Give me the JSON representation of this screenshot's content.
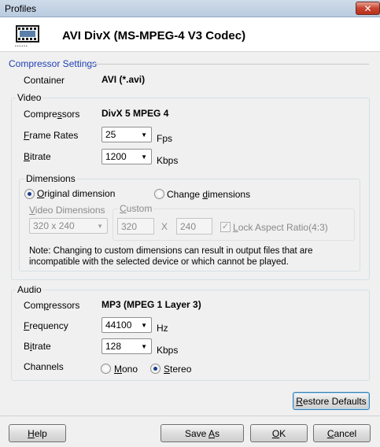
{
  "window": {
    "title": "Profiles",
    "close_label": "✕"
  },
  "header": {
    "title": "AVI DivX (MS-MPEG-4 V3 Codec)",
    "icon": "film-icon"
  },
  "compressor_settings": {
    "title": "Compressor Settings",
    "container_label": "Container",
    "container_value": "AVI (*.avi)"
  },
  "video": {
    "title": "Video",
    "compressors_label_pre": "Compre",
    "compressors_label_ul": "s",
    "compressors_label_post": "sors",
    "compressors_value": "DivX 5 MPEG 4",
    "frame_rates_label_pre": "",
    "frame_rates_label_ul": "F",
    "frame_rates_label_post": "rame Rates",
    "frame_rates_value": "25",
    "frame_rates_unit": "Fps",
    "bitrate_label_ul": "B",
    "bitrate_label_post": "itrate",
    "bitrate_value": "1200",
    "bitrate_unit": "Kbps",
    "dimensions": {
      "title": "Dimensions",
      "original_label_pre": "",
      "original_label_ul": "O",
      "original_label_post": "riginal dimension",
      "original_checked": true,
      "change_label_pre": "Change ",
      "change_label_ul": "d",
      "change_label_post": "imensions",
      "change_checked": false,
      "video_dimensions_label_ul": "V",
      "video_dimensions_label_post": "ideo Dimensions",
      "video_dimensions_value": "320 x 240",
      "custom_title_ul": "C",
      "custom_title_post": "ustom",
      "custom_width": "320",
      "custom_x": "X",
      "custom_height": "240",
      "lock_label_ul": "L",
      "lock_label_post": "ock Aspect Ratio(4:3)",
      "lock_checked": true,
      "note": "Note: Changing to custom dimensions can result in output files that are incompatible with the selected device or which cannot be played."
    }
  },
  "audio": {
    "title": "Audio",
    "compressors_label_pre": "Com",
    "compressors_label_ul": "p",
    "compressors_label_post": "ressors",
    "compressors_value": "MP3 (MPEG 1 Layer 3)",
    "frequency_label_ul": "F",
    "frequency_label_post": "requency",
    "frequency_value": "44100",
    "frequency_unit": "Hz",
    "bitrate_label_pre": "B",
    "bitrate_label_ul": "i",
    "bitrate_label_post": "trate",
    "bitrate_value": "128",
    "bitrate_unit": "Kbps",
    "channels_label": "Channels",
    "mono_label_ul": "M",
    "mono_label_post": "ono",
    "mono_checked": false,
    "stereo_label_ul": "S",
    "stereo_label_post": "tereo",
    "stereo_checked": true
  },
  "buttons": {
    "restore_ul": "R",
    "restore_post": "estore Defaults",
    "help_ul": "H",
    "help_post": "elp",
    "save_as_pre": "Save ",
    "save_as_ul": "A",
    "save_as_post": "s",
    "ok_ul": "O",
    "ok_post": "K",
    "cancel_ul": "C",
    "cancel_post": "ancel"
  }
}
